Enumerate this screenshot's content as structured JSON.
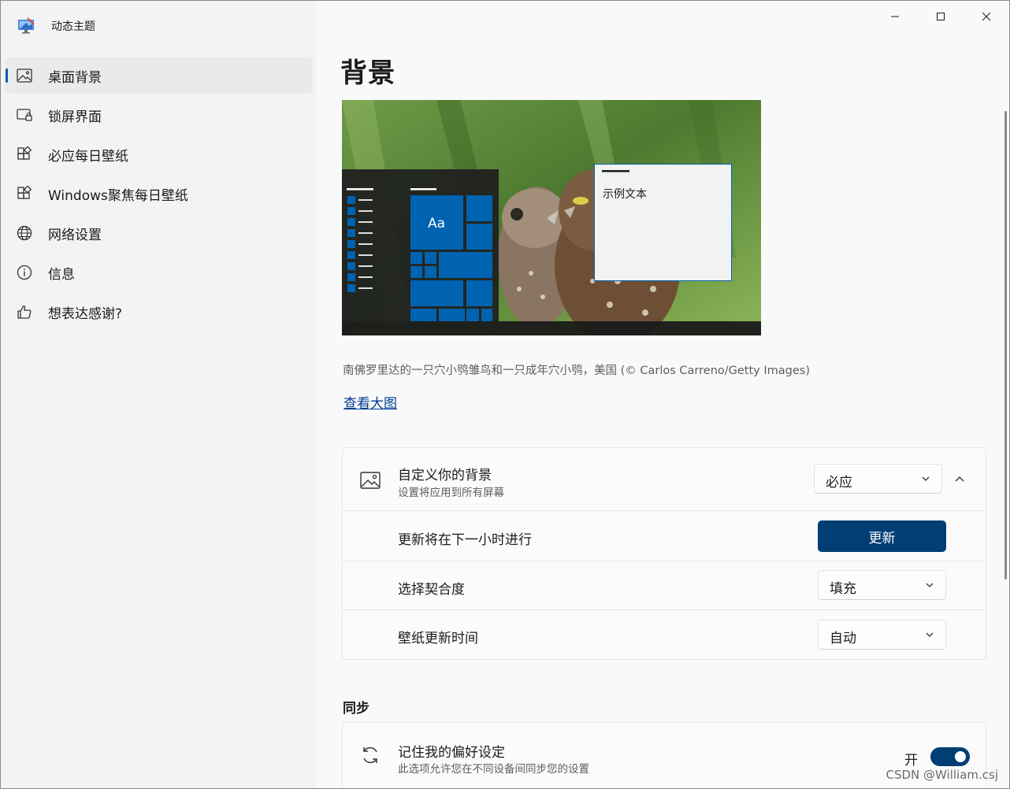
{
  "app": {
    "title": "动态主题",
    "icon": "monitor-palette-icon"
  },
  "window_controls": {
    "minimize": "minimize-icon",
    "maximize": "maximize-icon",
    "close": "close-icon"
  },
  "sidebar": {
    "items": [
      {
        "label": "桌面背景",
        "icon": "picture-icon",
        "active": true
      },
      {
        "label": "锁屏界面",
        "icon": "lock-screen-icon"
      },
      {
        "label": "必应每日壁纸",
        "icon": "apps-add-icon"
      },
      {
        "label": "Windows聚焦每日壁纸",
        "icon": "apps-add-icon"
      },
      {
        "label": "网络设置",
        "icon": "globe-icon"
      },
      {
        "label": "信息",
        "icon": "info-icon"
      },
      {
        "label": "想表达感谢?",
        "icon": "thumbs-up-icon"
      }
    ]
  },
  "main": {
    "title": "背景",
    "preview": {
      "sample_text": "示例文本",
      "tile_text": "Aa",
      "accent": "#0063b1"
    },
    "caption": "南佛罗里达的一只穴小鸮雏鸟和一只成年穴小鸮，美国 (© Carlos Carreno/Getty Images)",
    "view_link": "查看大图",
    "customize": {
      "title": "自定义你的背景",
      "subtitle": "设置将应用到所有屏幕",
      "source_value": "必应",
      "rows": {
        "update_label": "更新将在下一小时进行",
        "update_button": "更新",
        "fit_label": "选择契合度",
        "fit_value": "填充",
        "time_label": "壁纸更新时间",
        "time_value": "自动"
      }
    },
    "sync": {
      "heading": "同步",
      "title": "记住我的偏好设定",
      "subtitle": "此选项允许您在不同设备间同步您的设置",
      "toggle_label": "开",
      "toggle_on": true
    }
  },
  "watermark": "CSDN @William.csj",
  "colors": {
    "accent": "#003e74",
    "link": "#003e92",
    "sidebar_bg": "#f3f3f3"
  }
}
